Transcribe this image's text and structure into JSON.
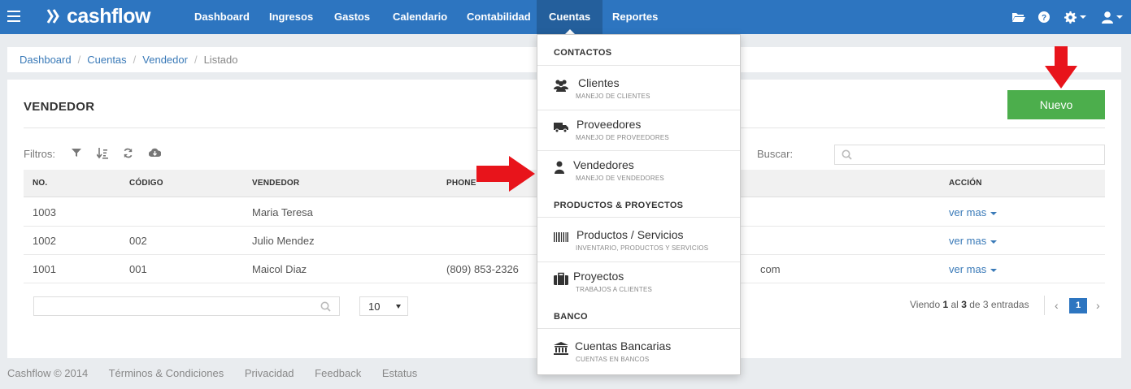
{
  "brand": {
    "name": "cashflow"
  },
  "nav": {
    "items": [
      {
        "label": "Dashboard"
      },
      {
        "label": "Ingresos"
      },
      {
        "label": "Gastos"
      },
      {
        "label": "Calendario"
      },
      {
        "label": "Contabilidad"
      },
      {
        "label": "Cuentas"
      },
      {
        "label": "Reportes"
      }
    ],
    "active": "Cuentas",
    "right_icons": [
      "folder-open-icon",
      "help-icon",
      "gear-icon",
      "user-icon"
    ]
  },
  "breadcrumb": {
    "items": [
      "Dashboard",
      "Cuentas",
      "Vendedor"
    ],
    "current": "Listado",
    "separator": "/"
  },
  "page": {
    "title": "VENDEDOR",
    "new_button": "Nuevo",
    "filters_label": "Filtros:",
    "filter_icons": [
      "filter-icon",
      "sort-icon",
      "refresh-icon",
      "cloud-download-icon"
    ],
    "search_label": "Buscar:",
    "search_placeholder": ""
  },
  "table": {
    "headers": [
      "NO.",
      "CÓDIGO",
      "VENDEDOR",
      "PHONE",
      "ACCIÓN"
    ],
    "rows": [
      {
        "no": "1003",
        "codigo": "",
        "vendedor": "Maria Teresa",
        "phone": "",
        "email_tail": "",
        "accion": "ver mas"
      },
      {
        "no": "1002",
        "codigo": "002",
        "vendedor": "Julio Mendez",
        "phone": "",
        "email_tail": "",
        "accion": "ver mas"
      },
      {
        "no": "1001",
        "codigo": "001",
        "vendedor": "Maicol Diaz",
        "phone": "(809) 853-2326",
        "email_tail": "com",
        "accion": "ver mas"
      }
    ]
  },
  "pagination": {
    "page_size": "10",
    "info_prefix": "Viendo ",
    "info_from": "1",
    "info_mid": " al ",
    "info_to": "3",
    "info_suffix": " de 3 entradas",
    "current_page": "1",
    "prev": "‹",
    "next": "›"
  },
  "footer": {
    "items": [
      "Cashflow © 2014",
      "Términos & Condiciones",
      "Privacidad",
      "Feedback",
      "Estatus"
    ]
  },
  "dropdown": {
    "sections": [
      {
        "header": "CONTACTOS",
        "items": [
          {
            "title": "Clientes",
            "subtitle": "MANEJO DE CLIENTES",
            "icon": "users-icon"
          },
          {
            "title": "Proveedores",
            "subtitle": "MANEJO DE PROVEEDORES",
            "icon": "truck-icon"
          },
          {
            "title": "Vendedores",
            "subtitle": "MANEJO DE VENDEDORES",
            "icon": "user-icon"
          }
        ]
      },
      {
        "header": "PRODUCTOS & PROYECTOS",
        "items": [
          {
            "title": "Productos / Servicios",
            "subtitle": "INVENTARIO, PRODUCTOS Y SERVICIOS",
            "icon": "barcode-icon"
          },
          {
            "title": "Proyectos",
            "subtitle": "TRABAJOS A CLIENTES",
            "icon": "briefcase-icon"
          }
        ]
      },
      {
        "header": "BANCO",
        "items": [
          {
            "title": "Cuentas Bancarias",
            "subtitle": "CUENTAS EN BANCOS",
            "icon": "bank-icon"
          }
        ]
      }
    ]
  },
  "colors": {
    "nav_bg": "#2d75c0",
    "nav_active": "#245f9c",
    "success": "#4cae4c",
    "link": "#3a7ab8",
    "annotation_arrow": "#e8141b"
  }
}
